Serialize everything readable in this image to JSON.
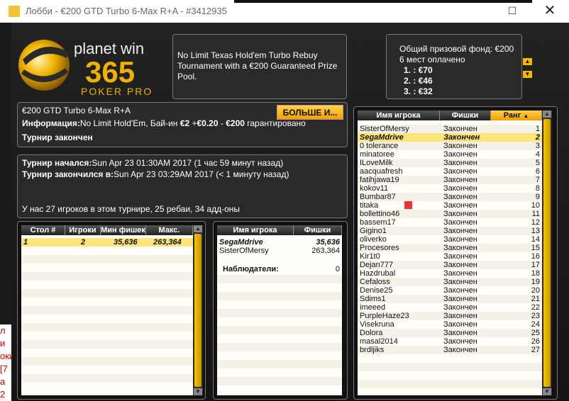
{
  "window": {
    "title": "Лобби - €200 GTD Turbo 6-Max R+A - #3412935",
    "close_glyph": "✕",
    "max_glyph": "☐"
  },
  "logo": {
    "line1": "planet win",
    "line2": "365",
    "line3": "POKER PRO"
  },
  "description": "No Limit Texas Hold'em Turbo Rebuy Tournament with a €200 Guaranteed Prize Pool.",
  "prize": {
    "label": "Общий призовой фонд: €200",
    "paid": "6 мест оплачено",
    "places": [
      "1. : €70",
      "2. : €46",
      "3. : €32"
    ]
  },
  "info": {
    "name": "€200 GTD Turbo 6-Max R+A",
    "more_button": "БОЛЬШЕ И...",
    "info_label": "Информация:",
    "info_text": "No Limit Hold'Em, Бай-ин",
    "buyin": "€2",
    "plus1": "+",
    "fee": "€0.20",
    "dash": "-",
    "guarantee": "€200",
    "guarantee_text": "гарантировано",
    "status": "Турнир закончен"
  },
  "times": {
    "start_label": "Турнир начался:",
    "start_text": "Sun Apr 23 01:30AM 2017 (1 час 59 минут назад)",
    "end_label": "Турнир закончился в:",
    "end_text": "Sun Apr 23 03:29AM 2017 (< 1 минуту назад)",
    "summary": "У нас 27 игроков в этом турнире, 25 ребаи, 34 адд-оны"
  },
  "tables": {
    "headers": [
      "Стол #",
      "Игроки",
      "Мин фишек",
      "Макс. Фишек"
    ],
    "rows": [
      [
        "1",
        "2",
        "35,636",
        "263,364"
      ]
    ]
  },
  "tableplayers": {
    "headers": [
      "Имя игрока",
      "Фишки"
    ],
    "rows": [
      [
        "SegaMdrive",
        "35,636"
      ],
      [
        "SisterOfMersy",
        "263,364"
      ]
    ],
    "observers_label": "Наблюдатели:",
    "observers_count": "0"
  },
  "players": {
    "headers": [
      "Имя игрока",
      "Фишки",
      "Ранг"
    ],
    "sort_glyph": "▲",
    "rows": [
      [
        "SisterOfMersy",
        "Закончен",
        "1"
      ],
      [
        "SegaMdrive",
        "Закончен",
        "2"
      ],
      [
        "0 tolerance",
        "Закончен",
        "3"
      ],
      [
        "minatoree",
        "Закончен",
        "4"
      ],
      [
        "ILoveMilk",
        "Закончен",
        "5"
      ],
      [
        "aacquafresh",
        "Закончен",
        "6"
      ],
      [
        "fatihjawa19",
        "Закончен",
        "7"
      ],
      [
        "kokov11",
        "Закончен",
        "8"
      ],
      [
        "Bumbar87",
        "Закончен",
        "9"
      ],
      [
        "titaka",
        "Закончен",
        "10"
      ],
      [
        "bollettino46",
        "Закончен",
        "11"
      ],
      [
        "bassem17",
        "Закончен",
        "12"
      ],
      [
        "Gigino1",
        "Закончен",
        "13"
      ],
      [
        "oliverko",
        "Закончен",
        "14"
      ],
      [
        "Procesores",
        "Закончен",
        "15"
      ],
      [
        "Kir1t0",
        "Закончен",
        "16"
      ],
      [
        "Dejan777",
        "Закончен",
        "17"
      ],
      [
        "Hazdrubal",
        "Закончен",
        "18"
      ],
      [
        "Cefaloss",
        "Закончен",
        "19"
      ],
      [
        "Denise25",
        "Закончен",
        "20"
      ],
      [
        "Sdims1",
        "Закончен",
        "21"
      ],
      [
        "imeeed",
        "Закончен",
        "22"
      ],
      [
        "PurpleHaze23",
        "Закончен",
        "23"
      ],
      [
        "Visekruna",
        "Закончен",
        "24"
      ],
      [
        "Dolora",
        "Закончен",
        "25"
      ],
      [
        "masal2014",
        "Закончен",
        "26"
      ],
      [
        "brdljiks",
        "Закончен",
        "27"
      ]
    ]
  },
  "left_strip": [
    "л и",
    "оки",
    "[7",
    "",
    "а 2"
  ]
}
